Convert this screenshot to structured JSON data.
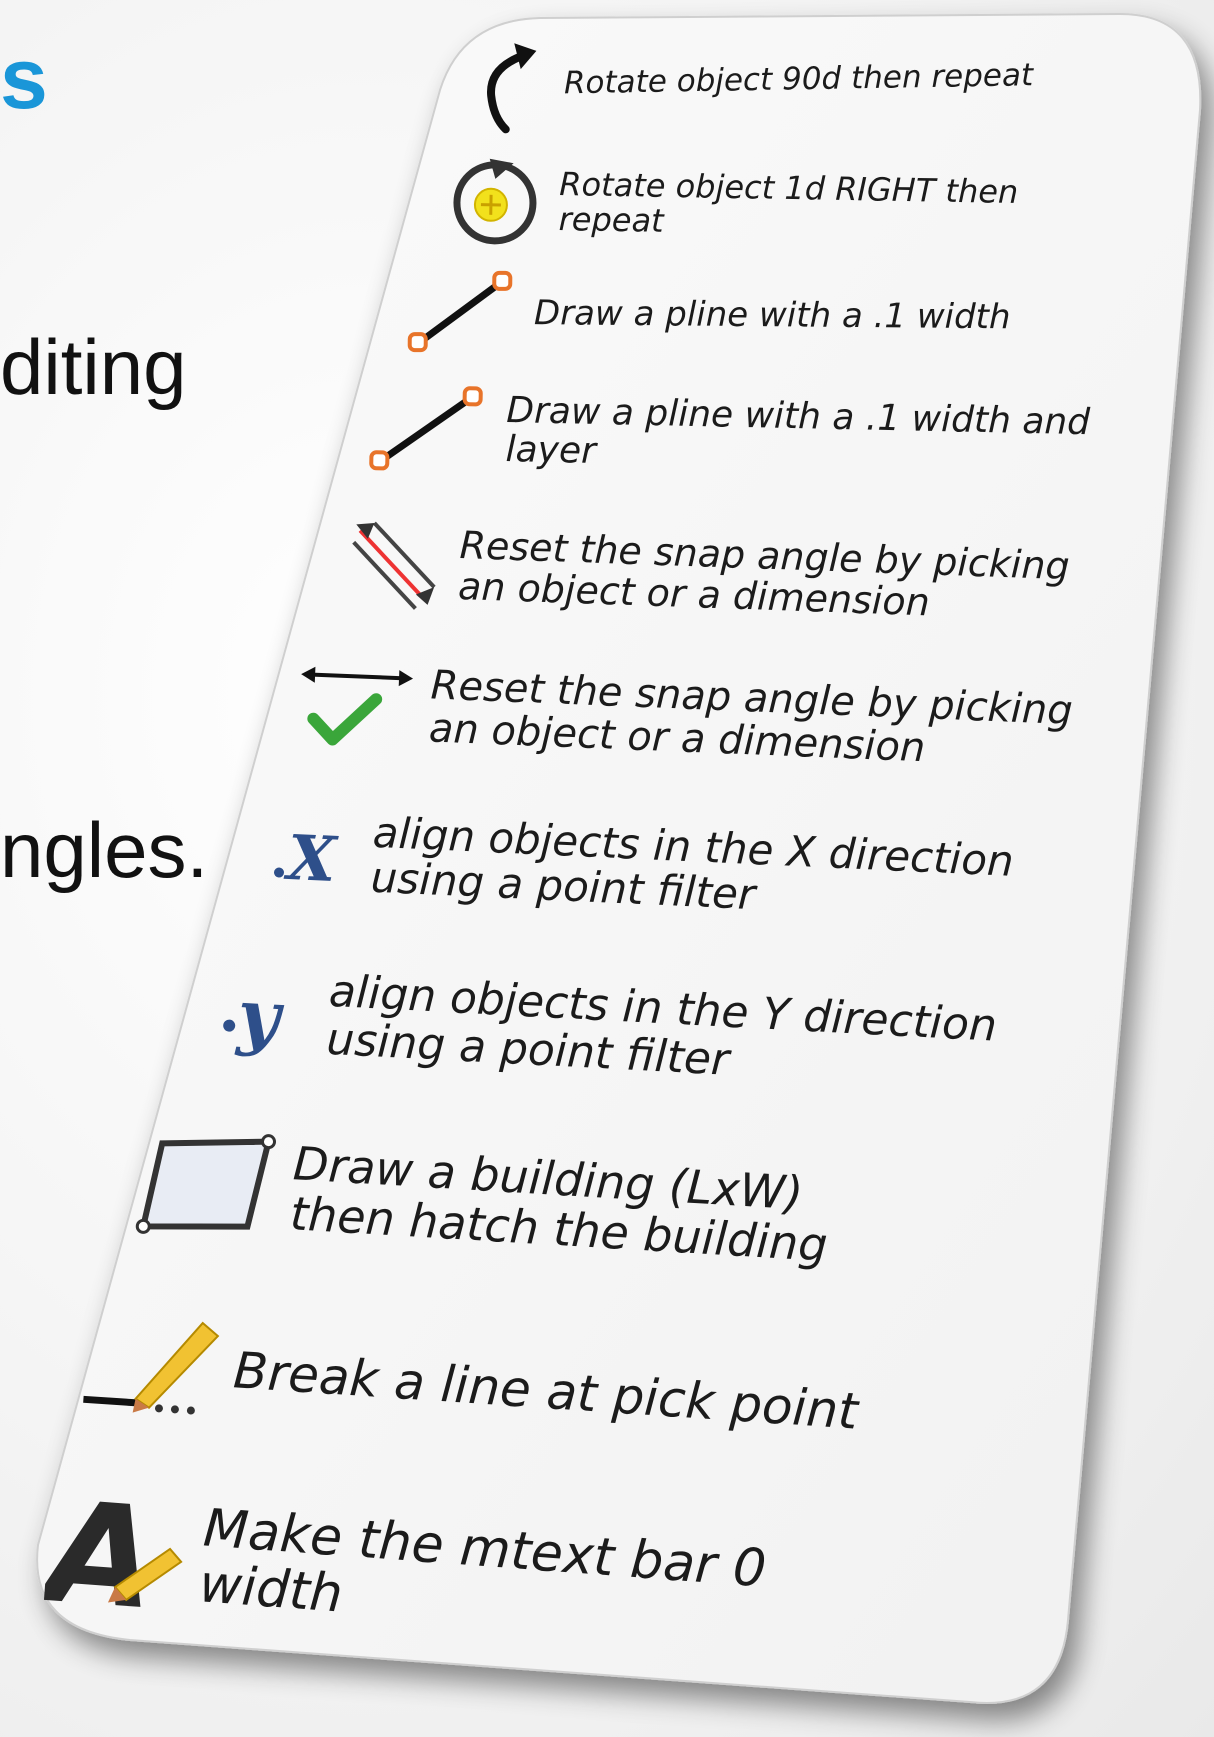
{
  "slide": {
    "title_fragment": "s",
    "body_fragment_1": "diting",
    "body_fragment_2": "ngles."
  },
  "toolbar": {
    "items": [
      {
        "label": "Rotate object 90d then repeat",
        "icon": "rotate-90-icon"
      },
      {
        "label": "Rotate object 1d RIGHT then repeat",
        "icon": "rotate-1d-icon"
      },
      {
        "label": "Draw a pline with a .1 width",
        "icon": "pline-icon"
      },
      {
        "label": "Draw a pline with a .1 width and layer",
        "icon": "pline-layer-icon"
      },
      {
        "label": "Reset the snap angle  by picking an object or a dimension",
        "icon": "snap-angle-dimension-icon"
      },
      {
        "label": "Reset the snap angle  by picking an object or a dimension",
        "icon": "snap-angle-check-icon"
      },
      {
        "label": "align objects in the X direction using a point filter",
        "icon": "x-filter-icon"
      },
      {
        "label": "align objects in the Y direction using a point filter",
        "icon": "y-filter-icon"
      },
      {
        "label": "Draw a building (LxW) then hatch the building",
        "icon": "building-icon"
      },
      {
        "label": "Break a line at pick point",
        "icon": "break-line-icon"
      },
      {
        "label": "Make the mtext bar 0 width",
        "icon": "mtext-icon"
      }
    ]
  },
  "colors": {
    "title_blue": "#1a96d8",
    "pline_orange": "#e8742a",
    "check_green": "#3aa63a",
    "filter_blue": "#2e4f8a",
    "rotate_yellow": "#f2e11c"
  }
}
